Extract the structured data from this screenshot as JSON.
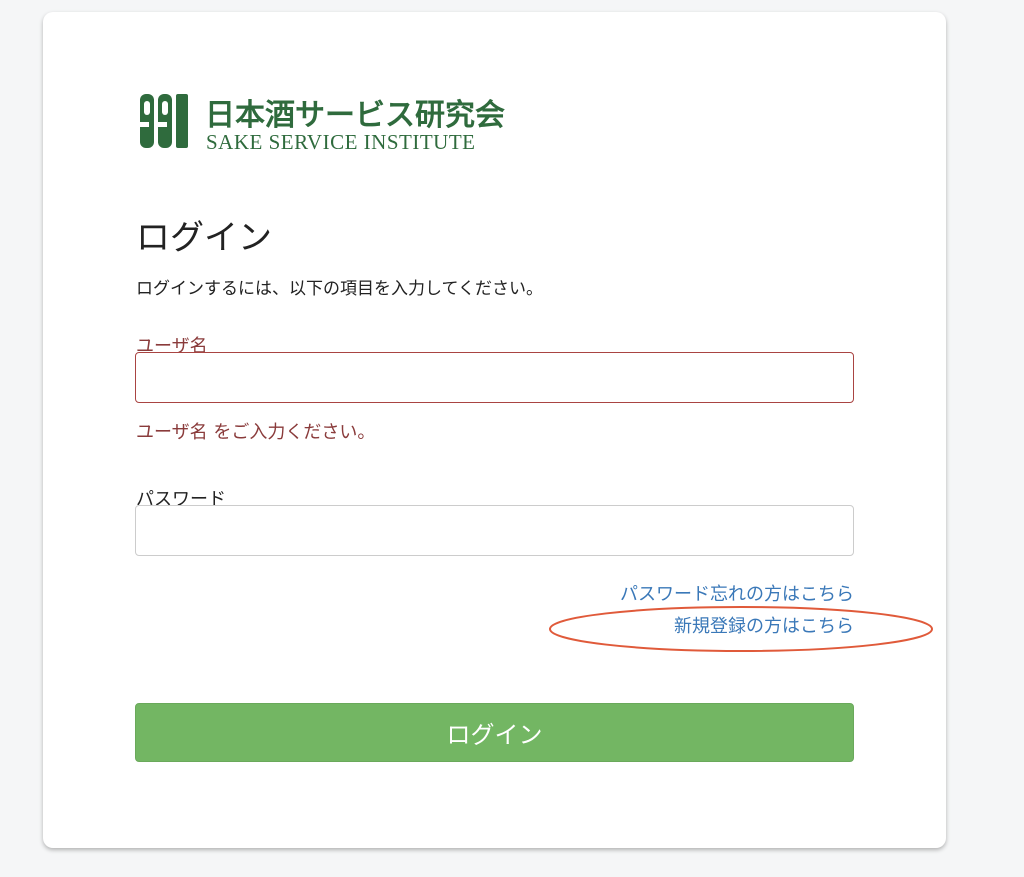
{
  "logo": {
    "mark_text": "991",
    "japanese_name": "日本酒サービス研究会",
    "english_name": "SAKE SERVICE INSTITUTE",
    "brand_color": "#2f6b3d"
  },
  "page": {
    "title": "ログイン",
    "instruction": "ログインするには、以下の項目を入力してください。"
  },
  "form": {
    "username": {
      "label": "ユーザ名",
      "value": "",
      "placeholder": "",
      "error": "ユーザ名 をご入力ください。",
      "error_color": "#a94442"
    },
    "password": {
      "label": "パスワード",
      "value": "",
      "placeholder": ""
    },
    "links": {
      "forgot_password": "パスワード忘れの方はこちら",
      "register": "新規登録の方はこちら"
    },
    "submit_label": "ログイン",
    "submit_color": "#73b663"
  },
  "annotation_color": "#e05a3a"
}
